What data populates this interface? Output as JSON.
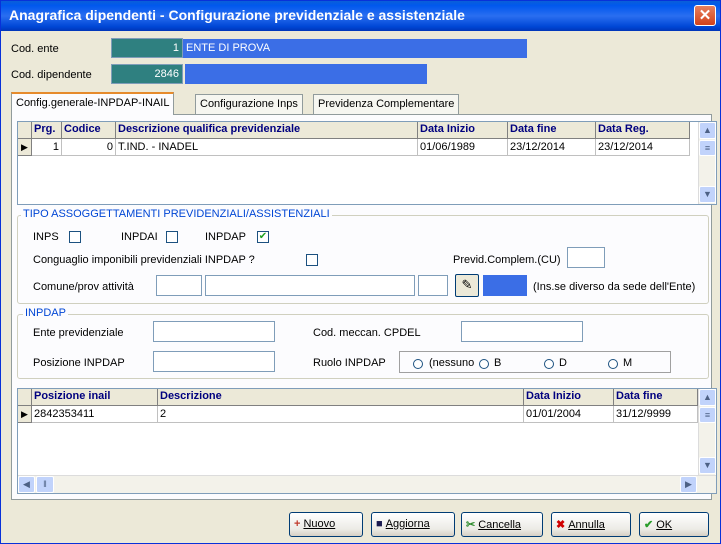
{
  "window": {
    "title": "Anagrafica dipendenti - Configurazione previdenziale e assistenziale"
  },
  "header": {
    "cod_ente_label": "Cod. ente",
    "cod_ente_value": "1",
    "ente_name": "ENTE DI PROVA",
    "cod_dipendente_label": "Cod. dipendente",
    "cod_dipendente_value": "2846",
    "dipendente_name": ""
  },
  "tabs": [
    {
      "label": "Config.generale-INPDAP-INAIL"
    },
    {
      "label": "Configurazione Inps"
    },
    {
      "label": "Previdenza Complementare"
    }
  ],
  "grid1": {
    "columns": [
      "Prg.",
      "Codice",
      "Descrizione qualifica previdenziale",
      "Data Inizio",
      "Data fine",
      "Data Reg."
    ],
    "rows": [
      [
        "1",
        "0",
        "T.IND. - INADEL",
        "01/06/1989",
        "23/12/2014",
        "23/12/2014"
      ]
    ]
  },
  "tipo_group": {
    "title": "TIPO ASSOGGETTAMENTI PREVIDENZIALI/ASSISTENZIALI",
    "inps_label": "INPS",
    "inps_checked": false,
    "inpdai_label": "INPDAI",
    "inpdai_checked": false,
    "inpdap_label": "INPDAP",
    "inpdap_checked": true,
    "conguaglio_label": "Conguaglio imponibili previdenziali INPDAP ?",
    "conguaglio_checked": false,
    "previd_label": "Previd.Complem.(CU)",
    "previd_value": "",
    "comune_label": "Comune/prov attività",
    "comune_note": "(Ins.se diverso da sede dell'Ente)"
  },
  "inpdap_group": {
    "title": "INPDAP",
    "ente_prev_label": "Ente previdenziale",
    "ente_prev_value": "",
    "cod_meccan_label": "Cod. meccan. CPDEL",
    "cod_meccan_value": "",
    "posizione_label": "Posizione INPDAP",
    "posizione_value": "",
    "ruolo_label": "Ruolo INPDAP",
    "ruolo_options": [
      "(nessuno)",
      "B",
      "D",
      "M"
    ],
    "ruolo_option_shown_0": "(nessuno",
    "ruolo_selected": null
  },
  "grid2": {
    "columns": [
      "Posizione inail",
      "Descrizione",
      "Data Inizio",
      "Data fine"
    ],
    "rows": [
      [
        "2842353411",
        "2",
        "01/01/2004",
        "31/12/9999"
      ]
    ]
  },
  "buttons": {
    "nuovo": "Nuovo",
    "aggiorna": "Aggiorna",
    "cancella": "Cancella",
    "annulla": "Annulla",
    "ok": "OK"
  },
  "colors": {
    "title_bar": "#0058ee",
    "teal_field": "#2f8080",
    "blue_field": "#3b6ee6",
    "group_title": "#0046d5",
    "grid_header_text": "#00007f"
  },
  "icons": {
    "close": "close-icon",
    "picker": "picker-icon",
    "nuovo": "new-icon",
    "aggiorna": "save-icon",
    "cancella": "delete-icon",
    "annulla": "cancel-icon",
    "ok": "ok-icon"
  }
}
